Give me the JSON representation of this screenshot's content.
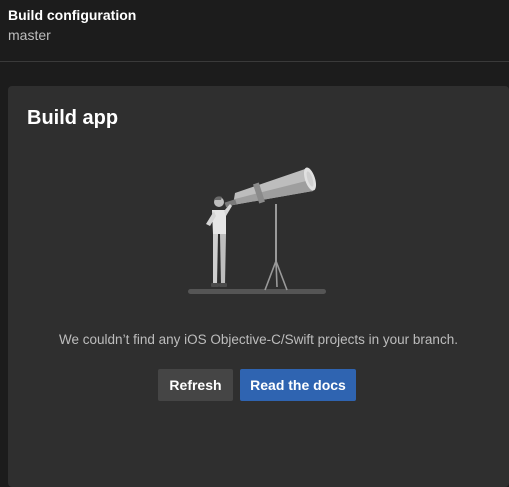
{
  "header": {
    "title": "Build configuration",
    "branch": "master"
  },
  "panel": {
    "title": "Build app",
    "illustration": "telescope-person-illustration",
    "message": "We couldn’t find any iOS Objective-C/Swift projects in your branch.",
    "refresh_label": "Refresh",
    "docs_label": "Read the docs"
  },
  "colors": {
    "background": "#1c1c1c",
    "panel": "#2f2f2f",
    "primary_button": "#2f64b1",
    "secondary_button": "#454545"
  }
}
